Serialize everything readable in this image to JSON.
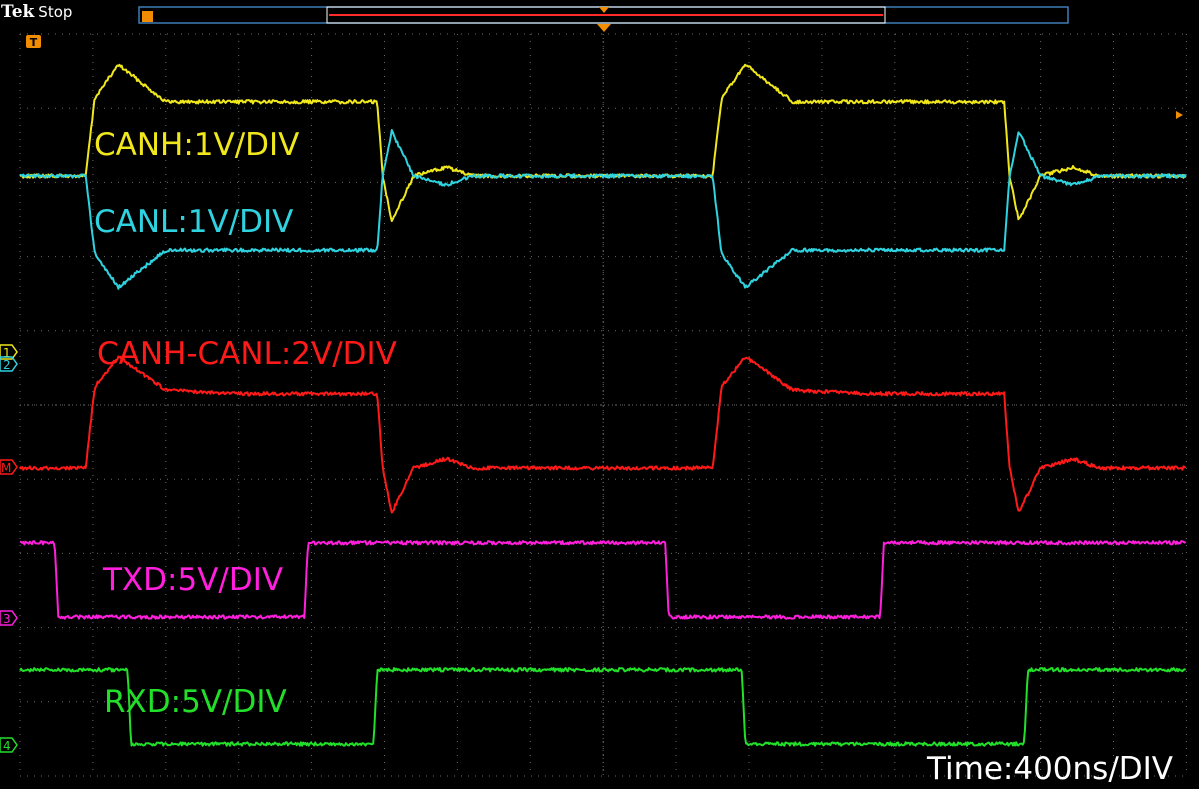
{
  "header": {
    "brand": "Tek",
    "status": "Stop"
  },
  "markers": {
    "trigger": "T",
    "ch1": "1",
    "ch2": "2",
    "math": "M",
    "ch3": "3",
    "ch4": "4"
  },
  "labels": {
    "canh": "CANH:1V/DIV",
    "canl": "CANL:1V/DIV",
    "diff": "CANH-CANL:2V/DIV",
    "txd": "TXD:5V/DIV",
    "rxd": "RXD:5V/DIV"
  },
  "timebase": "Time:400ns/DIV",
  "colors": {
    "canh": "#f0e81c",
    "canl": "#2fd3e0",
    "diff": "#ff1a1a",
    "txd": "#ff1fdc",
    "rxd": "#22e02a",
    "grid": "#6a6a6a",
    "record": "#3f7fb5",
    "marker": "#f28c00"
  },
  "chart_data": {
    "type": "line",
    "xlim": [
      -1600,
      1600
    ],
    "x_unit": "ns",
    "grid": true,
    "series": [
      {
        "name": "CANH",
        "volts_per_div": 1,
        "volts": [
          [
            -1600,
            2.5
          ],
          [
            -1420,
            2.5
          ],
          [
            -1395,
            3.55
          ],
          [
            -1330,
            4.0
          ],
          [
            -1200,
            3.5
          ],
          [
            -1000,
            3.5
          ],
          [
            -800,
            3.5
          ],
          [
            -620,
            3.5
          ],
          [
            -605,
            2.5
          ],
          [
            -580,
            1.9
          ],
          [
            -520,
            2.5
          ],
          [
            -430,
            2.62
          ],
          [
            -360,
            2.5
          ],
          [
            -200,
            2.5
          ],
          [
            0,
            2.5
          ],
          [
            200,
            2.5
          ],
          [
            300,
            2.5
          ],
          [
            325,
            3.55
          ],
          [
            390,
            4.0
          ],
          [
            520,
            3.5
          ],
          [
            720,
            3.5
          ],
          [
            920,
            3.5
          ],
          [
            1100,
            3.5
          ],
          [
            1115,
            2.5
          ],
          [
            1140,
            1.9
          ],
          [
            1200,
            2.5
          ],
          [
            1290,
            2.62
          ],
          [
            1360,
            2.5
          ],
          [
            1600,
            2.5
          ]
        ]
      },
      {
        "name": "CANL",
        "volts_per_div": 1,
        "volts": [
          [
            -1600,
            2.5
          ],
          [
            -1420,
            2.5
          ],
          [
            -1395,
            1.45
          ],
          [
            -1330,
            1.0
          ],
          [
            -1200,
            1.5
          ],
          [
            -1000,
            1.5
          ],
          [
            -800,
            1.5
          ],
          [
            -620,
            1.5
          ],
          [
            -605,
            2.5
          ],
          [
            -580,
            3.1
          ],
          [
            -520,
            2.5
          ],
          [
            -430,
            2.38
          ],
          [
            -360,
            2.5
          ],
          [
            -200,
            2.5
          ],
          [
            0,
            2.5
          ],
          [
            200,
            2.5
          ],
          [
            300,
            2.5
          ],
          [
            325,
            1.45
          ],
          [
            390,
            1.0
          ],
          [
            520,
            1.5
          ],
          [
            720,
            1.5
          ],
          [
            920,
            1.5
          ],
          [
            1100,
            1.5
          ],
          [
            1115,
            2.5
          ],
          [
            1140,
            3.1
          ],
          [
            1200,
            2.5
          ],
          [
            1290,
            2.38
          ],
          [
            1360,
            2.5
          ],
          [
            1600,
            2.5
          ]
        ]
      },
      {
        "name": "CANH-CANL",
        "volts_per_div": 2,
        "volts": [
          [
            -1600,
            0
          ],
          [
            -1420,
            0
          ],
          [
            -1395,
            2.2
          ],
          [
            -1330,
            3.0
          ],
          [
            -1200,
            2.1
          ],
          [
            -1000,
            2.0
          ],
          [
            -800,
            2.0
          ],
          [
            -620,
            2.0
          ],
          [
            -605,
            0
          ],
          [
            -580,
            -1.2
          ],
          [
            -520,
            0
          ],
          [
            -430,
            0.25
          ],
          [
            -360,
            0
          ],
          [
            -200,
            0
          ],
          [
            0,
            0
          ],
          [
            200,
            0
          ],
          [
            300,
            0
          ],
          [
            325,
            2.2
          ],
          [
            390,
            3.0
          ],
          [
            520,
            2.1
          ],
          [
            720,
            2.0
          ],
          [
            920,
            2.0
          ],
          [
            1100,
            2.0
          ],
          [
            1115,
            0
          ],
          [
            1140,
            -1.2
          ],
          [
            1200,
            0
          ],
          [
            1290,
            0.25
          ],
          [
            1360,
            0
          ],
          [
            1600,
            0
          ]
        ]
      },
      {
        "name": "TXD",
        "volts_per_div": 5,
        "volts": [
          [
            -1600,
            5
          ],
          [
            -1505,
            5
          ],
          [
            -1495,
            0
          ],
          [
            -1000,
            0
          ],
          [
            -820,
            0
          ],
          [
            -810,
            5
          ],
          [
            -500,
            5
          ],
          [
            0,
            5
          ],
          [
            170,
            5
          ],
          [
            180,
            0
          ],
          [
            600,
            0
          ],
          [
            760,
            0
          ],
          [
            770,
            5
          ],
          [
            1600,
            5
          ]
        ]
      },
      {
        "name": "RXD",
        "volts_per_div": 5,
        "volts": [
          [
            -1600,
            5
          ],
          [
            -1305,
            5
          ],
          [
            -1295,
            0
          ],
          [
            -1000,
            0
          ],
          [
            -630,
            0
          ],
          [
            -620,
            5
          ],
          [
            -200,
            5
          ],
          [
            0,
            5
          ],
          [
            380,
            5
          ],
          [
            390,
            0
          ],
          [
            800,
            0
          ],
          [
            1155,
            0
          ],
          [
            1165,
            5
          ],
          [
            1600,
            5
          ]
        ]
      }
    ]
  }
}
